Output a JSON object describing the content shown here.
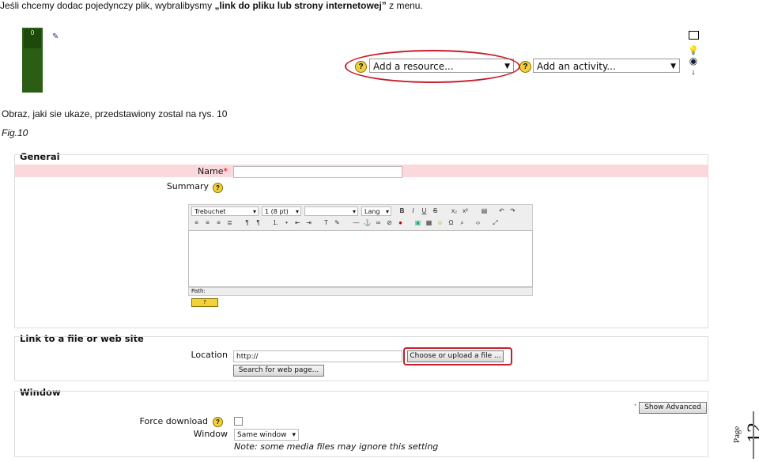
{
  "doc": {
    "line1_pre": "Jeśli chcemy dodac pojedynczy plik, wybralibysmy ",
    "line1_bold": "„link do pliku lub strony internetowej”",
    "line1_post": " z menu.",
    "line2": "Obraz, jaki sie ukaze, przedstawiony zostal na rys. 10",
    "fig": "Fig.10",
    "page_word": "Page",
    "page_number": "12"
  },
  "top": {
    "block_number": "0",
    "add_resource": "Add a resource...",
    "add_activity": "Add an activity...",
    "help_glyph": "?"
  },
  "form": {
    "general_title": "General",
    "name_label": "Name",
    "required_mark": "*",
    "summary_label": "Summary",
    "editor": {
      "font_family": "Trebuchet",
      "font_size": "1 (8 pt)",
      "lang": "Lang",
      "path_label": "Path:",
      "help_button": "?"
    },
    "link_title": "Link to a file or web site",
    "location_label": "Location",
    "location_value": "http://",
    "choose_button": "Choose or upload a file ...",
    "search_button": "Search for web page...",
    "window_title": "Window",
    "show_advanced": "Show Advanced",
    "force_download_label": "Force download",
    "window_label": "Window",
    "window_value": "Same window",
    "note": "Note: some media files may ignore this setting"
  },
  "colors": {
    "highlight_red": "#c81e2e",
    "name_row_bg": "#fbd8dc",
    "green_block": "#2b5e14"
  },
  "icons": [
    "pencil-icon",
    "help-icon",
    "square-icon",
    "lightbulb-icon",
    "eye-icon",
    "arrow-down-icon",
    "checkbox-icon"
  ]
}
